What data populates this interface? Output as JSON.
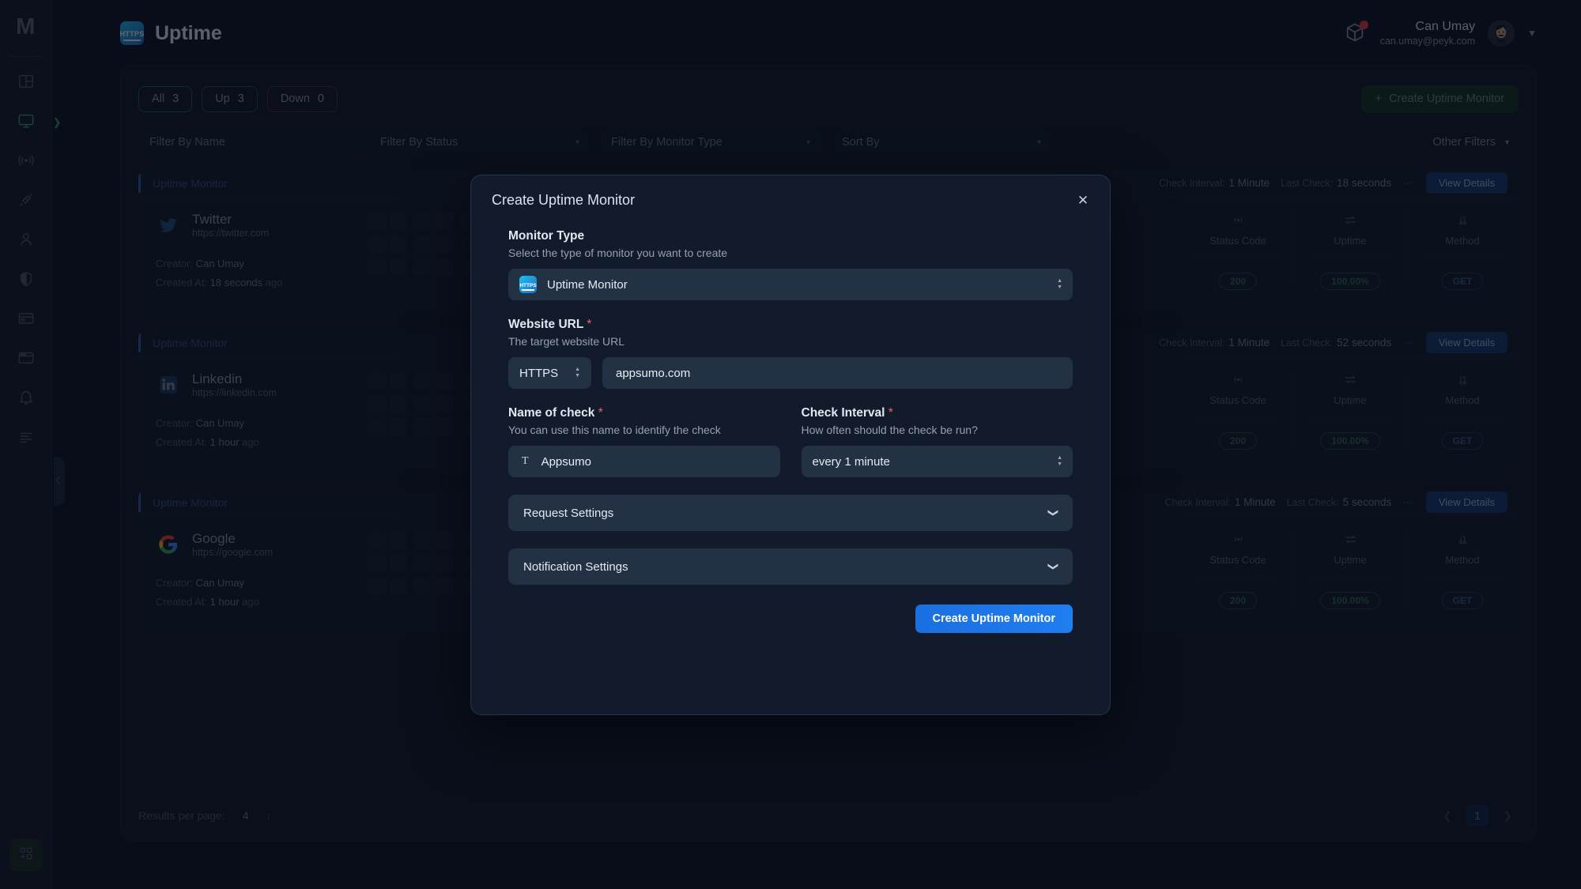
{
  "sidebar": {
    "logo": "M",
    "items": [
      {
        "icon": "dashboard-panels-icon",
        "name": "dashboard"
      },
      {
        "icon": "monitor-screen-icon",
        "name": "monitoring",
        "active": true
      },
      {
        "icon": "broadcast-signal-icon",
        "name": "status"
      },
      {
        "icon": "plug-connector-icon",
        "name": "integrations"
      },
      {
        "icon": "user-icon",
        "name": "users"
      },
      {
        "icon": "shield-icon",
        "name": "security"
      },
      {
        "icon": "credit-card-icon",
        "name": "billing"
      },
      {
        "icon": "browser-window-icon",
        "name": "pages"
      },
      {
        "icon": "bell-icon",
        "name": "notifications"
      },
      {
        "icon": "list-lines-icon",
        "name": "logs"
      }
    ],
    "bottom_icon": "add-apps-grid-icon"
  },
  "header": {
    "icon": "https-icon",
    "title": "Uptime",
    "cube_icon": "package-cube-icon",
    "user_name": "Can Umay",
    "user_email": "can.umay@peyk.com",
    "avatar_icon": "avatar",
    "caret_icon": "chevron-down-icon"
  },
  "toolbar": {
    "chips": [
      {
        "label": "All",
        "count": "3",
        "variant": "all"
      },
      {
        "label": "Up",
        "count": "3",
        "variant": "up"
      },
      {
        "label": "Down",
        "count": "0",
        "variant": "down"
      }
    ],
    "create_button": "Create Uptime Monitor",
    "create_plus": "+"
  },
  "filters": {
    "name_placeholder": "Filter By Name",
    "status_placeholder": "Filter By Status",
    "type_placeholder": "Filter By Monitor Type",
    "sort_placeholder": "Sort By",
    "other_filters": "Other Filters"
  },
  "cards": [
    {
      "kind": "Uptime Monitor",
      "check_interval_label": "Check Interval:",
      "check_interval_value": "1 Minute",
      "last_check_label": "Last Check:",
      "last_check_value": "18 seconds",
      "view_details": "View Details",
      "site_name": "Twitter",
      "site_url": "https://twitter.com",
      "site_icon": "twitter-icon",
      "creator_label": "Creator:",
      "creator_value": "Can Umay",
      "created_label": "Created At:",
      "created_value": "18 seconds",
      "created_suffix": "ago",
      "stats": [
        {
          "icon": "broadcast-signal-icon",
          "label": "Status Code",
          "value": "200",
          "variant": "ok"
        },
        {
          "icon": "exchange-arrows-icon",
          "label": "Uptime",
          "value": "100.00%",
          "variant": "ok"
        },
        {
          "icon": "git-branch-icon",
          "label": "Method",
          "value": "GET",
          "variant": "method"
        }
      ]
    },
    {
      "kind": "Uptime Monitor",
      "check_interval_label": "Check Interval:",
      "check_interval_value": "1 Minute",
      "last_check_label": "Last Check:",
      "last_check_value": "52 seconds",
      "view_details": "View Details",
      "site_name": "Linkedin",
      "site_url": "https://linkedin.com",
      "site_icon": "linkedin-icon",
      "creator_label": "Creator:",
      "creator_value": "Can Umay",
      "created_label": "Created At:",
      "created_value": "1 hour",
      "created_suffix": "ago",
      "stats": [
        {
          "icon": "broadcast-signal-icon",
          "label": "Status Code",
          "value": "200",
          "variant": "ok"
        },
        {
          "icon": "exchange-arrows-icon",
          "label": "Uptime",
          "value": "100.00%",
          "variant": "ok"
        },
        {
          "icon": "git-branch-icon",
          "label": "Method",
          "value": "GET",
          "variant": "method"
        }
      ]
    },
    {
      "kind": "Uptime Monitor",
      "check_interval_label": "Check Interval:",
      "check_interval_value": "1 Minute",
      "last_check_label": "Last Check:",
      "last_check_value": "5 seconds",
      "view_details": "View Details",
      "site_name": "Google",
      "site_url": "https://google.com",
      "site_icon": "google-icon",
      "creator_label": "Creator:",
      "creator_value": "Can Umay",
      "created_label": "Created At:",
      "created_value": "1 hour",
      "created_suffix": "ago",
      "stats": [
        {
          "icon": "broadcast-signal-icon",
          "label": "Status Code",
          "value": "200",
          "variant": "ok"
        },
        {
          "icon": "exchange-arrows-icon",
          "label": "Uptime",
          "value": "100.00%",
          "variant": "ok"
        },
        {
          "icon": "git-branch-icon",
          "label": "Method",
          "value": "GET",
          "variant": "method"
        }
      ]
    }
  ],
  "pagination": {
    "results_label": "Results per page:",
    "results_value": "4",
    "prev_icon": "chevron-left-icon",
    "next_icon": "chevron-right-icon",
    "current_page": "1"
  },
  "modal": {
    "title": "Create Uptime Monitor",
    "close_icon": "close-icon",
    "monitor_type": {
      "label": "Monitor Type",
      "help": "Select the type of monitor you want to create",
      "value": "Uptime Monitor",
      "icon": "https-icon"
    },
    "website_url": {
      "label": "Website URL",
      "required_mark": "*",
      "help": "The target website URL",
      "protocol": "HTTPS",
      "value": "appsumo.com"
    },
    "name_of_check": {
      "label": "Name of check",
      "required_mark": "*",
      "help": "You can use this name to identify the check",
      "prefix_icon": "T",
      "value": "Appsumo"
    },
    "check_interval": {
      "label": "Check Interval",
      "required_mark": "*",
      "help": "How often should the check be run?",
      "value": "every 1 minute"
    },
    "request_settings": "Request Settings",
    "notification_settings": "Notification Settings",
    "submit": "Create Uptime Monitor"
  },
  "colors": {
    "accent_blue": "#1f7ef0",
    "green": "#2f9e63",
    "red": "#e23b3b",
    "page_bg": "#0c1220"
  }
}
